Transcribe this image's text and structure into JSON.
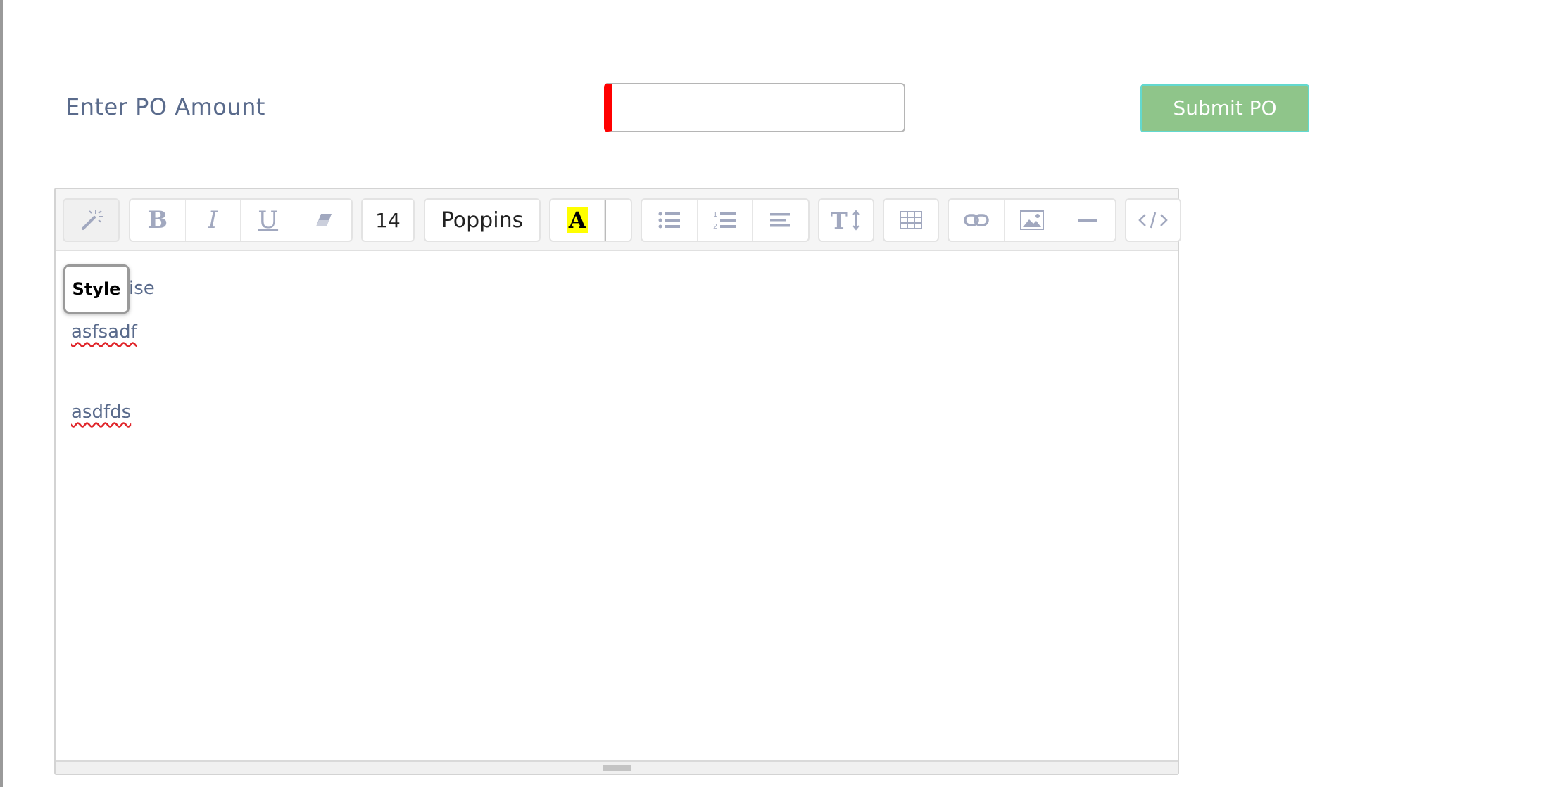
{
  "form": {
    "po_label": "Enter PO Amount",
    "po_value": "",
    "submit_label": "Submit PO"
  },
  "toolbar": {
    "font_size": "14",
    "font_name": "Poppins",
    "color_letter": "A",
    "bold_label": "B",
    "italic_label": "I",
    "underline_label": "U",
    "icons": [
      "magic-wand-icon",
      "bold-icon",
      "italic-icon",
      "underline-icon",
      "eraser-icon",
      "text-color-icon",
      "unordered-list-icon",
      "ordered-list-icon",
      "align-icon",
      "line-height-icon",
      "table-icon",
      "link-icon",
      "picture-icon",
      "hr-icon",
      "code-view-icon"
    ],
    "colors": {
      "highlight": "#ffff00",
      "icon": "#a1a8bf"
    }
  },
  "tooltip": {
    "text": "Style"
  },
  "editor": {
    "lines": [
      {
        "text": "ise"
      },
      {
        "text": "asfsadf"
      },
      {
        "text": "asdfds"
      }
    ]
  },
  "colors": {
    "submit_bg": "#8fc58a",
    "submit_border": "#63d9cf",
    "input_error": "#ff0000",
    "label": "#5a6b8c"
  }
}
